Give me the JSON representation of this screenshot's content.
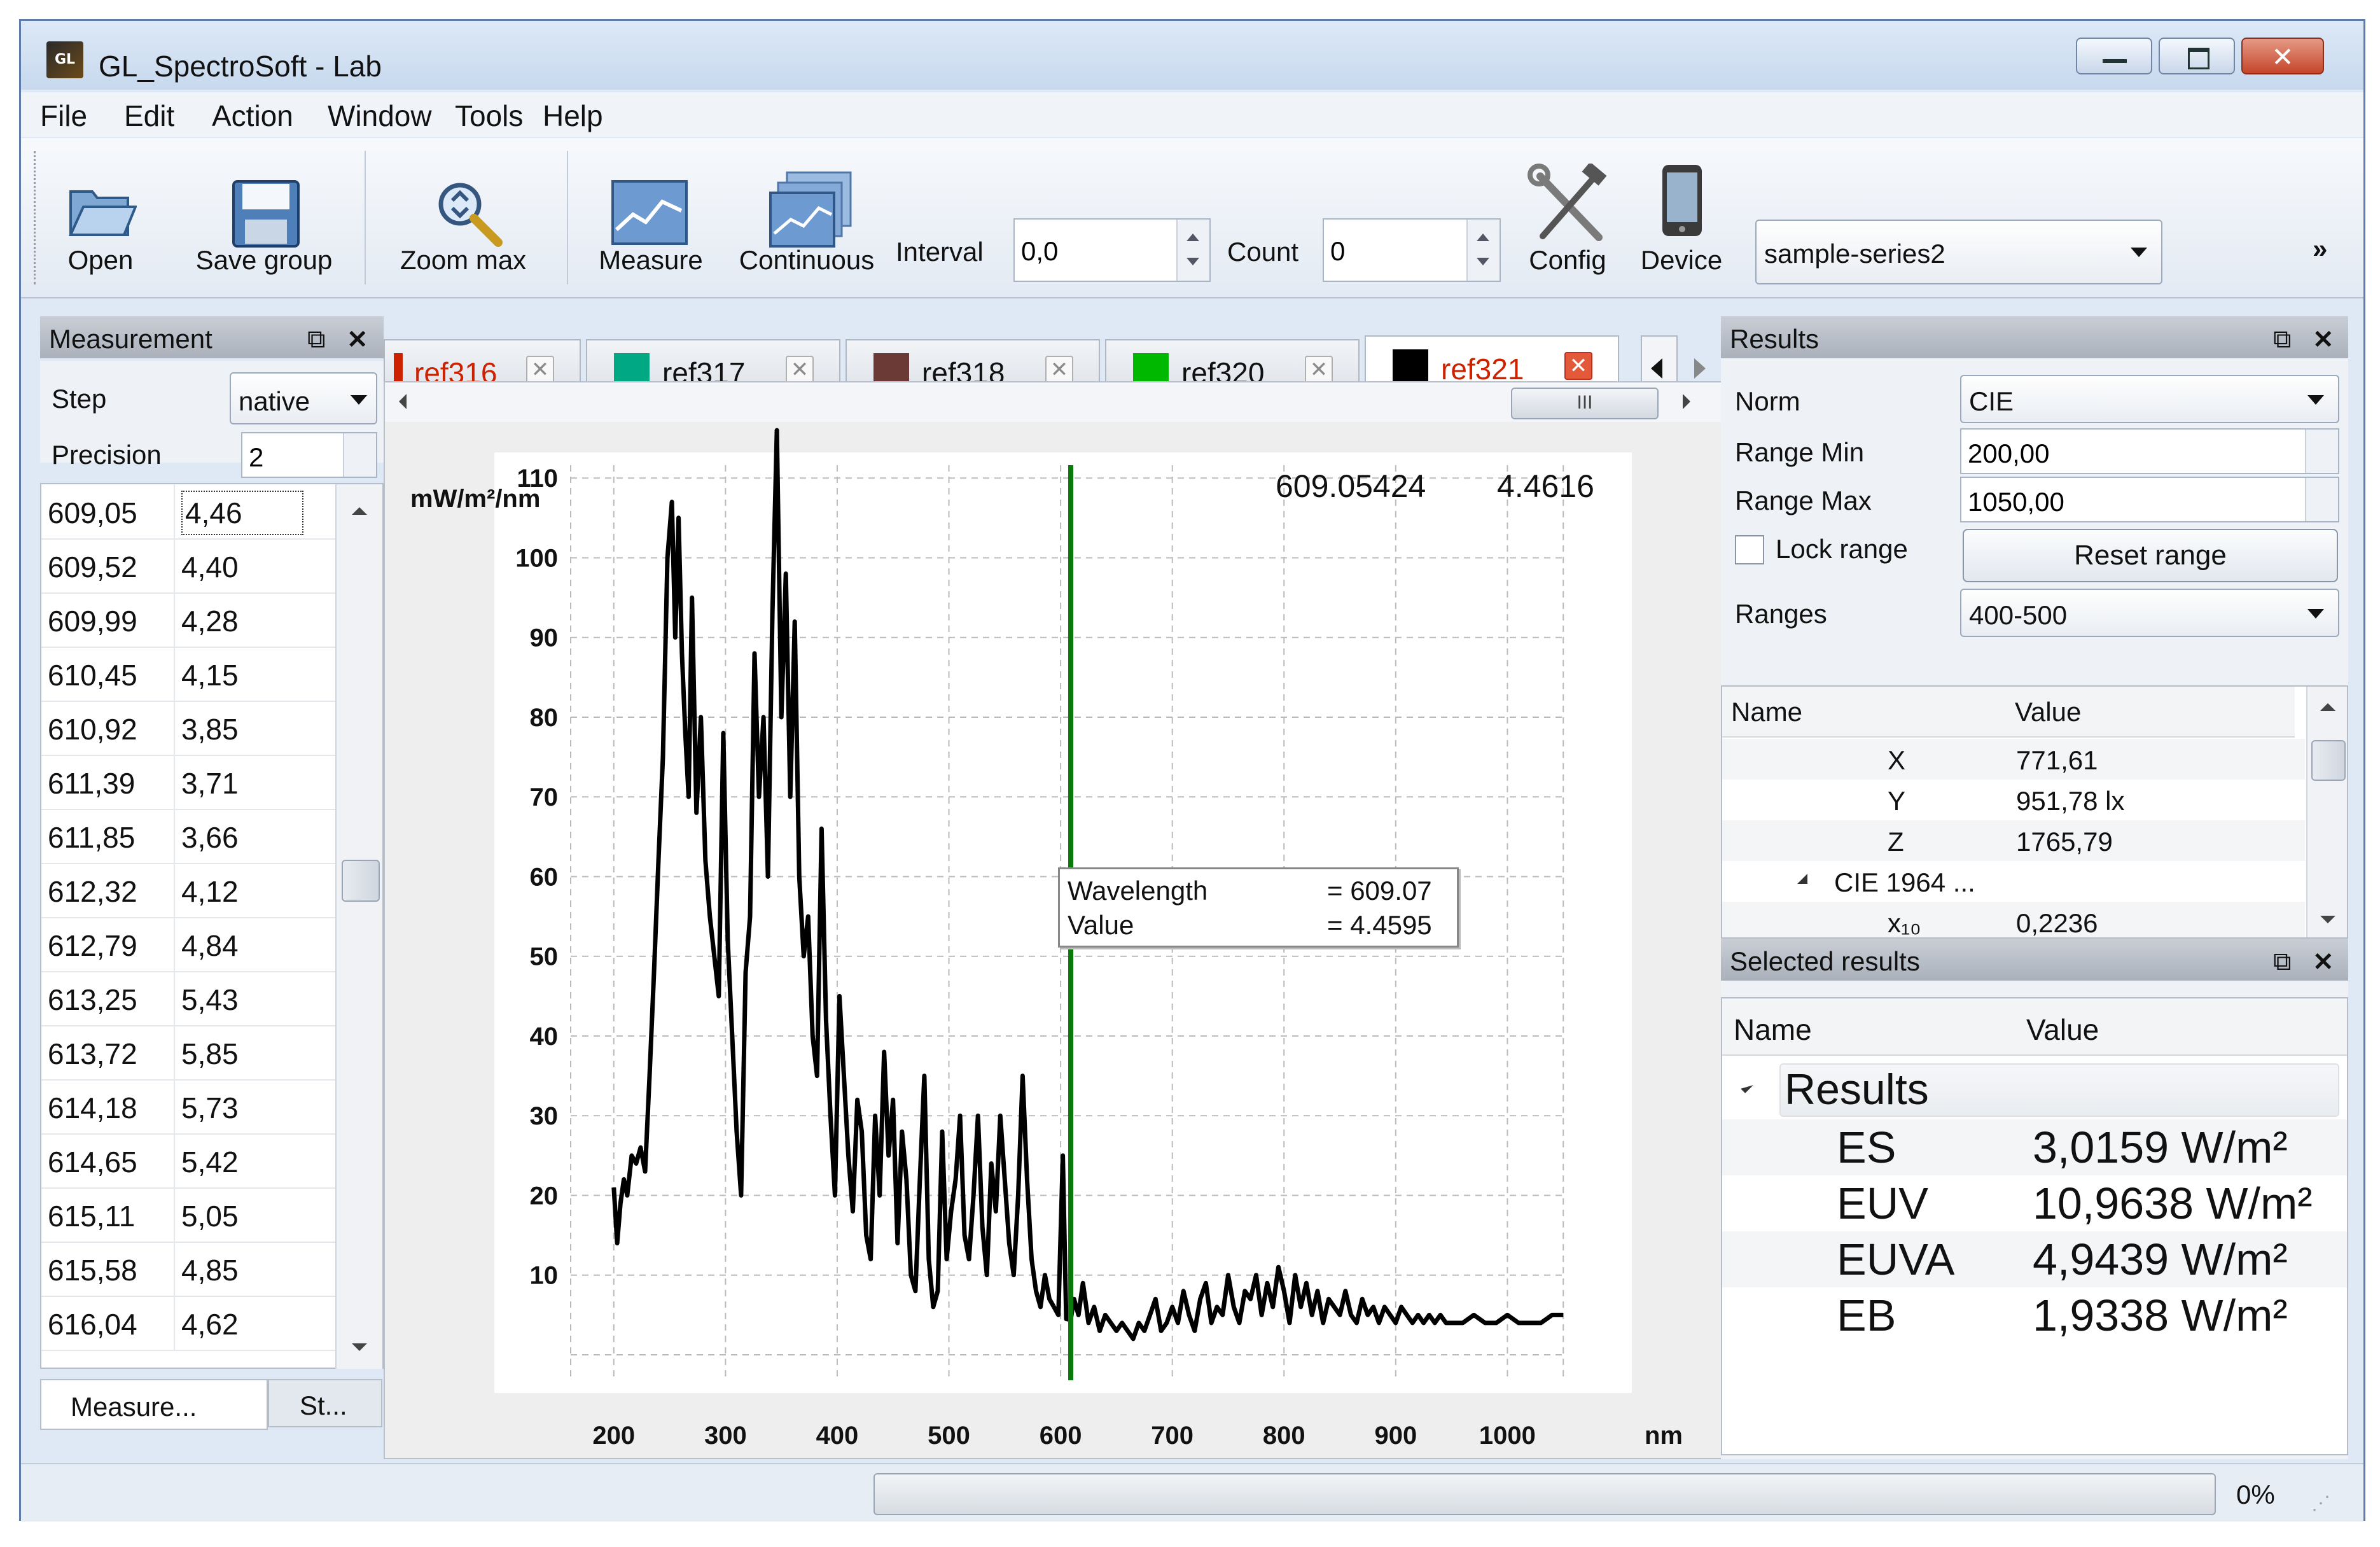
{
  "window": {
    "title": "GL_SpectroSoft - Lab",
    "icon_text": "GL",
    "controls": [
      "minimize-icon",
      "maximize-icon",
      "close-icon"
    ]
  },
  "menu": [
    "File",
    "Edit",
    "Action",
    "Window",
    "Tools",
    "Help"
  ],
  "toolbar": {
    "open": "Open",
    "save_group": "Save group",
    "zoom_max": "Zoom max",
    "measure": "Measure",
    "continuous": "Continuous",
    "interval_label": "Interval",
    "interval_value": "0,0",
    "count_label": "Count",
    "count_value": "0",
    "config": "Config",
    "device": "Device",
    "series": "sample-series2",
    "overflow": "»"
  },
  "measurement_panel": {
    "title": "Measurement",
    "step_label": "Step",
    "step_value": "native",
    "precision_label": "Precision",
    "precision_value": "2",
    "rows": [
      [
        "609,05",
        "4,46"
      ],
      [
        "609,52",
        "4,40"
      ],
      [
        "609,99",
        "4,28"
      ],
      [
        "610,45",
        "4,15"
      ],
      [
        "610,92",
        "3,85"
      ],
      [
        "611,39",
        "3,71"
      ],
      [
        "611,85",
        "3,66"
      ],
      [
        "612,32",
        "4,12"
      ],
      [
        "612,79",
        "4,84"
      ],
      [
        "613,25",
        "5,43"
      ],
      [
        "613,72",
        "5,85"
      ],
      [
        "614,18",
        "5,73"
      ],
      [
        "614,65",
        "5,42"
      ],
      [
        "615,11",
        "5,05"
      ],
      [
        "615,58",
        "4,85"
      ],
      [
        "616,04",
        "4,62"
      ]
    ],
    "tabs": [
      "Measure...",
      "St..."
    ]
  },
  "tabs": [
    {
      "name": "ref316",
      "color": "#cc2200",
      "active": false
    },
    {
      "name": "ref317",
      "color": "#00a884",
      "active": false
    },
    {
      "name": "ref318",
      "color": "#6b3a36",
      "active": false
    },
    {
      "name": "ref320",
      "color": "#00b800",
      "active": false
    },
    {
      "name": "ref321",
      "color": "#000000",
      "active": true
    }
  ],
  "chart": {
    "cursor_x": "609.05424",
    "cursor_y": "4.4616",
    "tooltip": {
      "wavelength_label": "Wavelength",
      "wavelength_value": "= 609.07",
      "value_label": "Value",
      "value_value": "= 4.4595"
    },
    "marker_color": "#0a7a0a"
  },
  "chart_data": {
    "type": "line",
    "ylabel": "mW/m²/nm",
    "xlabel": "nm",
    "xlim": [
      200,
      1050
    ],
    "ylim": [
      0,
      118
    ],
    "xticks": [
      200,
      300,
      400,
      500,
      600,
      700,
      800,
      900,
      1000
    ],
    "yticks": [
      10,
      20,
      30,
      40,
      50,
      60,
      70,
      80,
      90,
      100,
      110
    ],
    "grid": true,
    "marker_x": 609.07,
    "series": [
      {
        "color": "#000000",
        "x": [
          200,
          203,
          206,
          209,
          212,
          216,
          220,
          224,
          228,
          232,
          236,
          240,
          244,
          248,
          252,
          255,
          258,
          261,
          264,
          267,
          270,
          274,
          278,
          282,
          286,
          290,
          294,
          298,
          302,
          306,
          310,
          314,
          318,
          322,
          326,
          330,
          334,
          338,
          342,
          346,
          350,
          354,
          358,
          362,
          366,
          370,
          374,
          378,
          382,
          386,
          390,
          394,
          398,
          402,
          406,
          410,
          414,
          418,
          422,
          426,
          430,
          434,
          438,
          442,
          446,
          450,
          454,
          458,
          462,
          466,
          470,
          474,
          478,
          482,
          486,
          490,
          494,
          498,
          502,
          506,
          510,
          514,
          518,
          522,
          526,
          530,
          534,
          538,
          542,
          546,
          550,
          554,
          558,
          562,
          566,
          570,
          574,
          578,
          582,
          586,
          590,
          594,
          598,
          602,
          605,
          609,
          612,
          616,
          620,
          625,
          630,
          635,
          640,
          645,
          650,
          655,
          660,
          665,
          670,
          675,
          680,
          685,
          690,
          695,
          700,
          705,
          710,
          715,
          720,
          725,
          730,
          735,
          740,
          745,
          750,
          755,
          760,
          765,
          770,
          775,
          780,
          785,
          790,
          795,
          800,
          805,
          810,
          815,
          820,
          825,
          830,
          835,
          840,
          845,
          850,
          855,
          860,
          865,
          870,
          875,
          880,
          885,
          890,
          895,
          900,
          905,
          910,
          915,
          920,
          925,
          930,
          935,
          940,
          945,
          950,
          960,
          970,
          980,
          990,
          1000,
          1010,
          1020,
          1030,
          1040,
          1050
        ],
        "values": [
          21,
          14,
          19,
          22,
          20,
          25,
          24,
          26,
          23,
          35,
          48,
          62,
          75,
          100,
          107,
          90,
          105,
          88,
          78,
          70,
          95,
          68,
          80,
          62,
          55,
          50,
          45,
          78,
          52,
          40,
          28,
          20,
          48,
          55,
          88,
          70,
          80,
          60,
          93,
          116,
          80,
          98,
          70,
          92,
          60,
          50,
          55,
          40,
          35,
          66,
          42,
          30,
          20,
          45,
          35,
          25,
          18,
          32,
          28,
          15,
          12,
          30,
          20,
          38,
          25,
          32,
          14,
          28,
          22,
          10,
          8,
          22,
          35,
          12,
          6,
          8,
          28,
          12,
          18,
          22,
          30,
          15,
          12,
          20,
          30,
          16,
          10,
          24,
          18,
          30,
          22,
          14,
          10,
          20,
          35,
          22,
          12,
          8,
          6,
          10,
          7,
          6,
          5,
          25,
          4.5,
          4.4,
          7,
          5,
          9,
          4,
          6,
          3,
          5,
          4,
          3,
          4,
          3,
          2,
          4,
          3,
          5,
          7,
          3,
          4,
          6,
          4,
          8,
          5,
          3,
          7,
          9,
          4,
          6,
          5,
          10,
          6,
          4,
          8,
          7,
          10,
          5,
          9,
          6,
          11,
          8,
          4,
          10,
          6,
          9,
          5,
          8,
          4,
          7,
          6,
          5,
          8,
          5,
          4,
          7,
          5,
          6,
          4,
          6,
          5,
          4,
          6,
          5,
          4,
          5,
          4,
          5,
          4,
          5,
          4,
          4,
          4,
          5,
          4,
          4,
          5,
          4,
          4,
          4,
          5,
          5
        ]
      }
    ]
  },
  "results_panel": {
    "title": "Results",
    "norm_label": "Norm",
    "norm_value": "CIE",
    "range_min_label": "Range Min",
    "range_min_value": "200,00",
    "range_max_label": "Range Max",
    "range_max_value": "1050,00",
    "lock_range_label": "Lock range",
    "reset_range_label": "Reset range",
    "ranges_label": "Ranges",
    "ranges_value": "400-500",
    "col_name": "Name",
    "col_value": "Value",
    "rows": [
      {
        "name": "X",
        "value": "771,61"
      },
      {
        "name": "Y",
        "value": "951,78 lx"
      },
      {
        "name": "Z",
        "value": "1765,79"
      },
      {
        "name": "CIE 1964 ...",
        "value": ""
      },
      {
        "name": "x₁₀",
        "value": "0,2236"
      }
    ]
  },
  "selected_results": {
    "title": "Selected results",
    "col_name": "Name",
    "col_value": "Value",
    "group": "Results",
    "rows": [
      {
        "name": "ES",
        "value": "3,0159 W/m²"
      },
      {
        "name": "EUV",
        "value": "10,9638 W/m²"
      },
      {
        "name": "EUVA",
        "value": "4,9439 W/m²"
      },
      {
        "name": "EB",
        "value": "1,9338 W/m²"
      }
    ]
  },
  "status": {
    "progress_percent": "0%",
    "progress_fraction": 0
  }
}
